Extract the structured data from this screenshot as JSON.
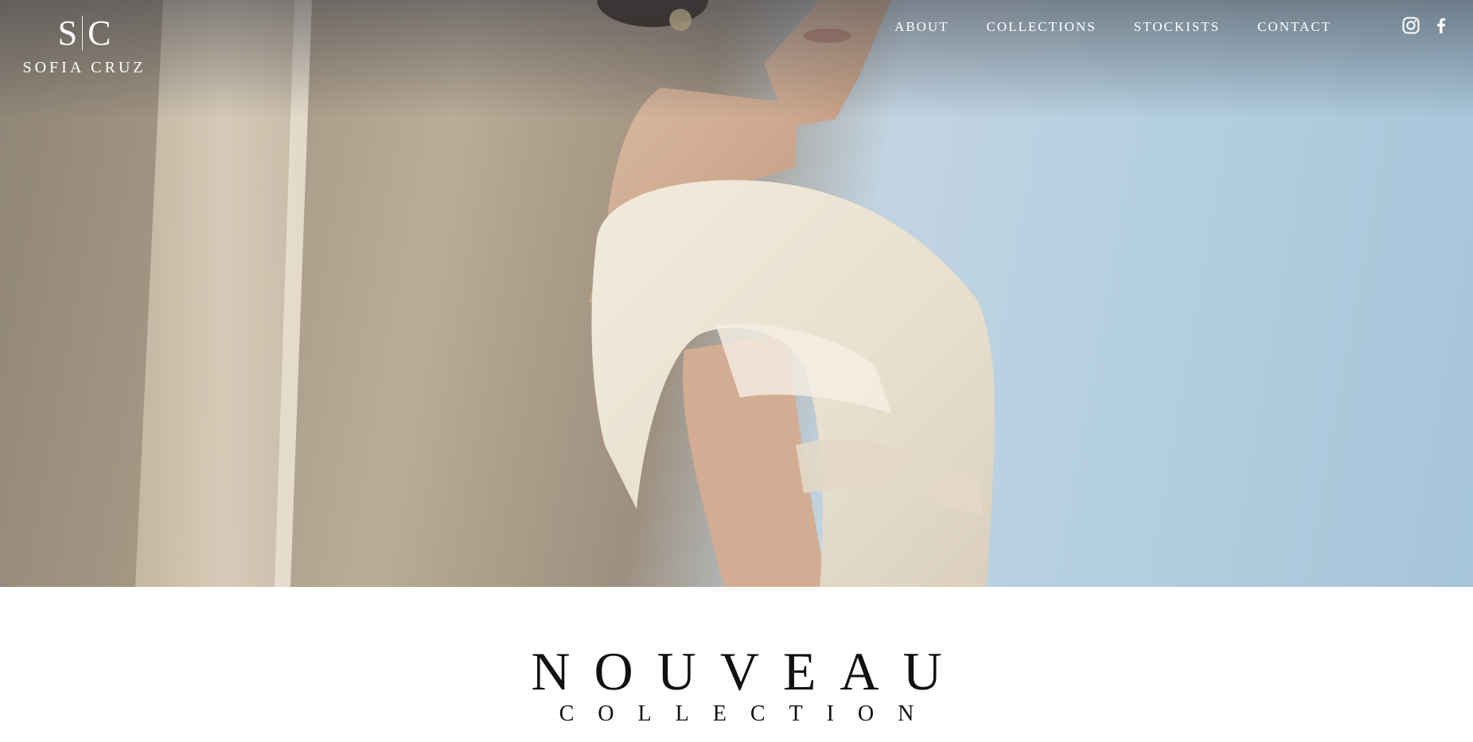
{
  "brand": {
    "monogram_left": "S",
    "monogram_right": "C",
    "name": "SOFIA CRUZ"
  },
  "nav": {
    "items": [
      {
        "label": "ABOUT"
      },
      {
        "label": "COLLECTIONS"
      },
      {
        "label": "STOCKISTS"
      },
      {
        "label": "CONTACT"
      }
    ],
    "social": [
      {
        "icon": "instagram-icon"
      },
      {
        "icon": "facebook-icon"
      }
    ]
  },
  "hero": {
    "image": "bride-in-off-shoulder-ivory-gown"
  },
  "collection": {
    "title": "NOUVEAU",
    "subtitle": "COLLECTION"
  },
  "colors": {
    "nav_text": "#ffffff",
    "title_text": "#111111",
    "background": "#ffffff"
  }
}
